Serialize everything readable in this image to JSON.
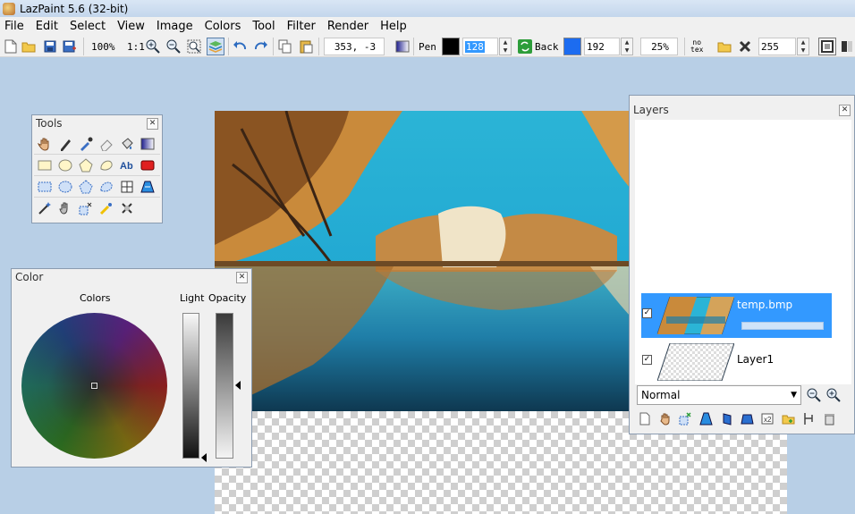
{
  "window": {
    "title": "LazPaint 5.6 (32-bit)"
  },
  "menu": [
    "File",
    "Edit",
    "Select",
    "View",
    "Image",
    "Colors",
    "Tool",
    "Filter",
    "Render",
    "Help"
  ],
  "toolbar": {
    "zoom": "100%",
    "zoom_ratio": "1:1",
    "cursor_coords": "353, -3",
    "pen_label": "Pen",
    "pen_color": "#000000",
    "pen_alpha": "128",
    "back_label": "Back",
    "back_color": "#1c6cf0",
    "back_alpha": "192",
    "tolerance": "25%",
    "no_texture_label": "no\ntex",
    "texture_alpha": "255"
  },
  "tools_panel": {
    "title": "Tools",
    "rows": [
      [
        "hand-icon",
        "pen-icon",
        "color-picker-icon",
        "eraser-icon",
        "fill-bucket-icon",
        "gradient-icon"
      ],
      [
        "rectangle-icon",
        "ellipse-icon",
        "polygon-icon",
        "spline-icon",
        "text-icon",
        "rounded-rect-icon"
      ],
      [
        "select-rect-icon",
        "select-ellipse-icon",
        "select-poly-icon",
        "select-spline-icon",
        "deform-grid-icon",
        "perspective-icon"
      ],
      [
        "magic-wand-icon",
        "select-pen-icon",
        "move-selection-icon",
        "rotate-selection-icon",
        "clone-stamp-icon"
      ]
    ]
  },
  "color_panel": {
    "title": "Color",
    "colors_label": "Colors",
    "light_label": "Light",
    "opacity_label": "Opacity"
  },
  "layers_panel": {
    "title": "Layers",
    "layers": [
      {
        "name": "temp.bmp",
        "visible": true,
        "selected": true
      },
      {
        "name": "Layer1",
        "visible": true,
        "selected": false
      }
    ],
    "blend_mode": "Normal"
  }
}
